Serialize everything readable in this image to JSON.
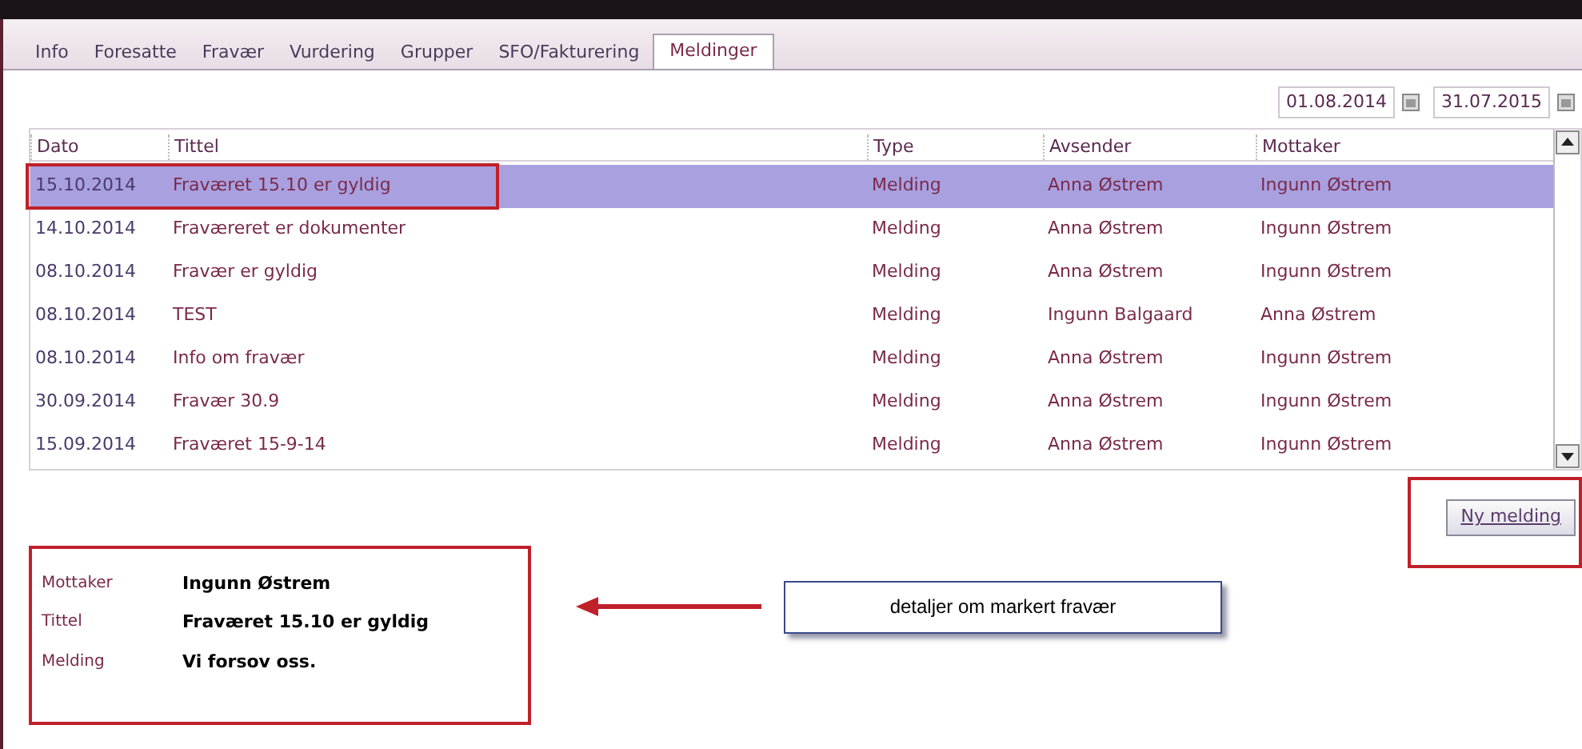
{
  "tabs": [
    {
      "label": "Info",
      "selected": false
    },
    {
      "label": "Foresatte",
      "selected": false
    },
    {
      "label": "Fravær",
      "selected": false
    },
    {
      "label": "Vurdering",
      "selected": false
    },
    {
      "label": "Grupper",
      "selected": false
    },
    {
      "label": "SFO/Fakturering",
      "selected": false
    },
    {
      "label": "Meldinger",
      "selected": true
    }
  ],
  "date_range": {
    "from": "01.08.2014",
    "to": "31.07.2015"
  },
  "table": {
    "columns": [
      "Dato",
      "Tittel",
      "Type",
      "Avsender",
      "Mottaker"
    ],
    "rows": [
      {
        "cells": [
          "15.10.2014",
          "Fraværet 15.10 er gyldig",
          "Melding",
          "Anna Østrem",
          "Ingunn Østrem"
        ],
        "selected": true
      },
      {
        "cells": [
          "14.10.2014",
          "Fraværeret er dokumenter",
          "Melding",
          "Anna Østrem",
          "Ingunn Østrem"
        ],
        "selected": false
      },
      {
        "cells": [
          "08.10.2014",
          "Fravær er gyldig",
          "Melding",
          "Anna Østrem",
          "Ingunn Østrem"
        ],
        "selected": false
      },
      {
        "cells": [
          "08.10.2014",
          "TEST",
          "Melding",
          "Ingunn Balgaard",
          "Anna Østrem"
        ],
        "selected": false
      },
      {
        "cells": [
          "08.10.2014",
          "Info om fravær",
          "Melding",
          "Anna Østrem",
          "Ingunn Østrem"
        ],
        "selected": false
      },
      {
        "cells": [
          "30.09.2014",
          "Fravær 30.9",
          "Melding",
          "Anna Østrem",
          "Ingunn Østrem"
        ],
        "selected": false
      },
      {
        "cells": [
          "15.09.2014",
          "Fraværet 15-9-14",
          "Melding",
          "Anna Østrem",
          "Ingunn Østrem"
        ],
        "selected": false
      }
    ]
  },
  "new_message_button": {
    "label": "Ny melding"
  },
  "details": [
    {
      "label": "Mottaker",
      "value": "Ingunn Østrem"
    },
    {
      "label": "Tittel",
      "value": "Fraværet 15.10 er gyldig"
    },
    {
      "label": "Melding",
      "value": "Vi forsov oss."
    }
  ],
  "callout": {
    "text": "detaljer om markert fravær"
  }
}
